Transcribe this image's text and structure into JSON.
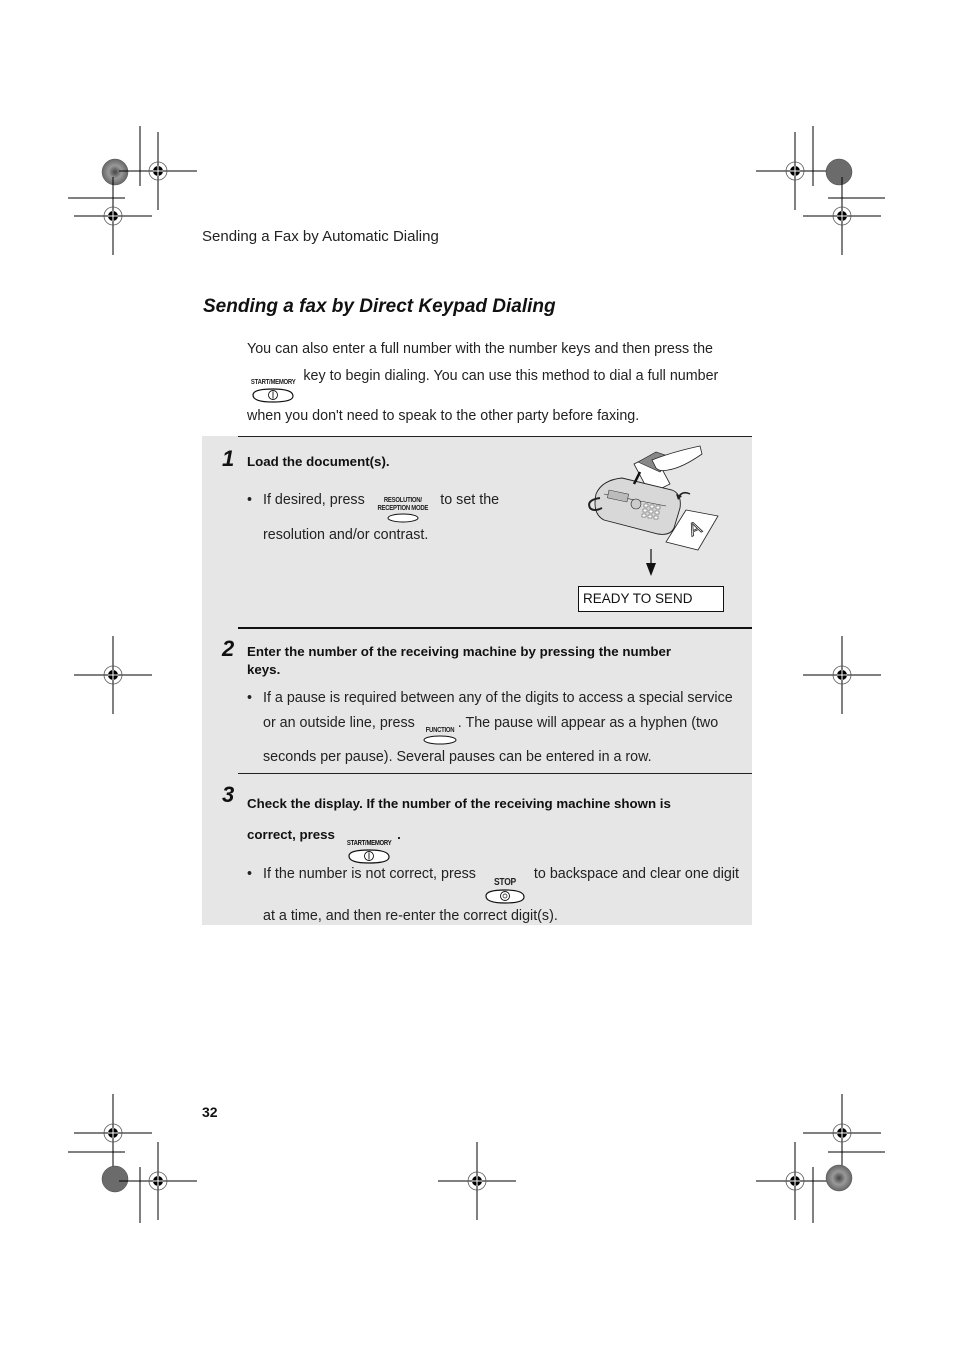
{
  "running_head": "Sending a Fax by Automatic Dialing",
  "section_title": "Sending a fax by Direct Keypad Dialing",
  "intro": {
    "line1": "You can also enter a full number with the number keys and then press the",
    "key_label": "START/MEMORY",
    "line2": "key to begin dialing. You can use this method to dial a full number",
    "line3": "when you don't need to speak to the other party before faxing."
  },
  "steps": [
    {
      "number": "1",
      "heading": "Load the document(s).",
      "bullet": {
        "before": "If desired, press",
        "key_label_top": "RESOLUTION/",
        "key_label_bottom": "RECEPTION MODE",
        "after": "to set the",
        "line2": "resolution and/or contrast."
      },
      "display": "READY TO SEND",
      "illustration": "fax-machine-loading-document-icon"
    },
    {
      "number": "2",
      "heading_line1": "Enter the number of the receiving machine by pressing the number",
      "heading_line2": "keys.",
      "bullet": {
        "line1": "If a pause is required between any of the digits to access a special service",
        "before": "or an outside line, press",
        "key_label": "FUNCTION",
        "after": ". The pause will appear as a hyphen (two",
        "line3": "seconds per pause). Several pauses can be entered in a row."
      }
    },
    {
      "number": "3",
      "heading_line1": "Check the display. If the number of the receiving machine shown is",
      "heading_before": "correct, press",
      "key_label": "START/MEMORY",
      "heading_after": ".",
      "bullet": {
        "before": "If the number is not correct, press",
        "key_label": "STOP",
        "after": "to backspace and clear one digit",
        "line2": "at a time, and then re-enter the correct digit(s)."
      }
    }
  ],
  "page_number": "32",
  "bullet_char": "•",
  "colors": {
    "step_panel_bg": "#e6e6e6",
    "text": "#111111"
  }
}
